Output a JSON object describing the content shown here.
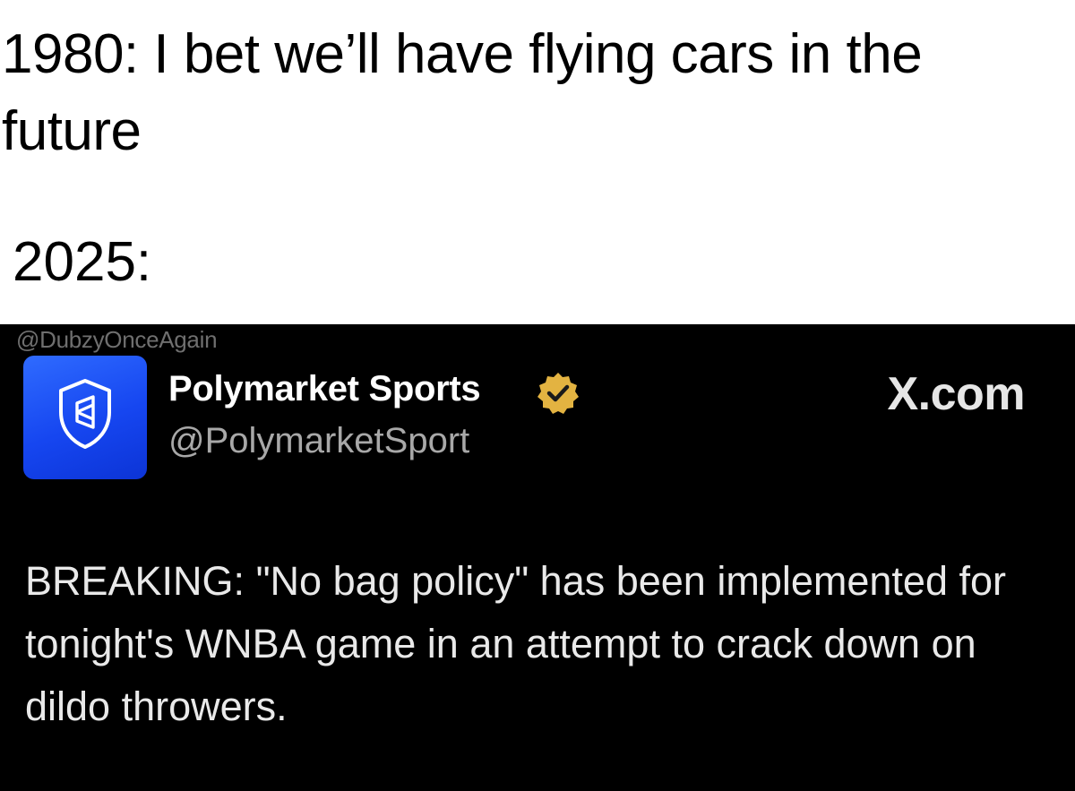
{
  "meme": {
    "caption_top": "1980: I bet we’ll have flying cars in the future",
    "caption_year": "2025:"
  },
  "tweet": {
    "watermark": "@DubzyOnceAgain",
    "author_name": "Polymarket Sports",
    "author_handle": "@PolymarketSport",
    "site_label": "X.com",
    "body": "BREAKING: \"No bag policy\" has been implemented for tonight's WNBA game in an attempt to crack down on dildo throwers.",
    "avatar_icon": "shield-logo-icon",
    "verified_icon": "verified-badge-icon"
  },
  "colors": {
    "tweet_background": "#000000",
    "avatar_blue": "#1646f0",
    "verified_gold": "#e3b341",
    "handle_gray": "#a8a8a8"
  }
}
